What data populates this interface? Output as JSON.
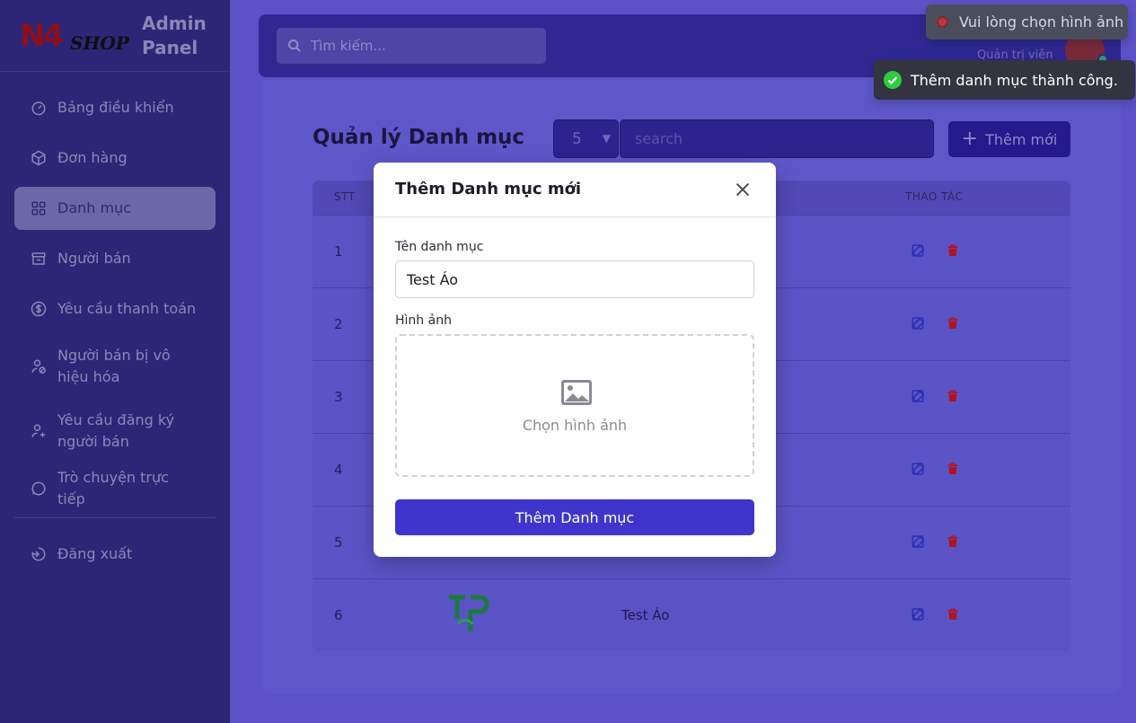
{
  "brand": {
    "logo_text": "N4",
    "logo_sub": "SHOP",
    "title_line1": "Admin",
    "title_line2": "Panel"
  },
  "sidebar": {
    "items": [
      {
        "label": "Bảng điều khiển",
        "icon": "dashboard-icon"
      },
      {
        "label": "Đơn hàng",
        "icon": "box-icon"
      },
      {
        "label": "Danh mục",
        "icon": "grid-icon",
        "active": true
      },
      {
        "label": "Người bán",
        "icon": "store-icon"
      },
      {
        "label": "Yêu cầu thanh toán",
        "icon": "dollar-icon"
      },
      {
        "label": "Người bán bị vô hiệu hóa",
        "icon": "user-ban-icon"
      },
      {
        "label": "Yêu cầu đăng ký người bán",
        "icon": "user-plus-icon"
      },
      {
        "label": "Trò chuyện trực tiếp",
        "icon": "chat-icon"
      }
    ],
    "logout_label": "Đăng xuất"
  },
  "header": {
    "search_placeholder": "Tìm kiếm...",
    "role": "Quản trị viên"
  },
  "main": {
    "title": "Quản lý Danh mục",
    "per_page": "5",
    "search_placeholder": "search",
    "add_label": "Thêm mới",
    "table": {
      "headers": {
        "stt": "STT",
        "actions": "THAO TÁC"
      },
      "rows": [
        {
          "stt": "1",
          "name": ""
        },
        {
          "stt": "2",
          "name": ""
        },
        {
          "stt": "3",
          "name": ""
        },
        {
          "stt": "4",
          "name": ""
        },
        {
          "stt": "5",
          "name": ""
        },
        {
          "stt": "6",
          "name": "Test Áo"
        }
      ]
    }
  },
  "modal": {
    "title": "Thêm Danh mục mới",
    "name_label": "Tên danh mục",
    "name_value": "Test Áo",
    "image_label": "Hình ảnh",
    "image_placeholder": "Chọn hình ảnh",
    "submit_label": "Thêm Danh mục"
  },
  "toasts": {
    "error": "Vui lòng chọn hình ảnh",
    "success": "Thêm danh mục thành công."
  },
  "colors": {
    "accent": "#3f35cc",
    "error": "#c4313b",
    "success": "#2ecc40",
    "delete": "#b3121f"
  }
}
